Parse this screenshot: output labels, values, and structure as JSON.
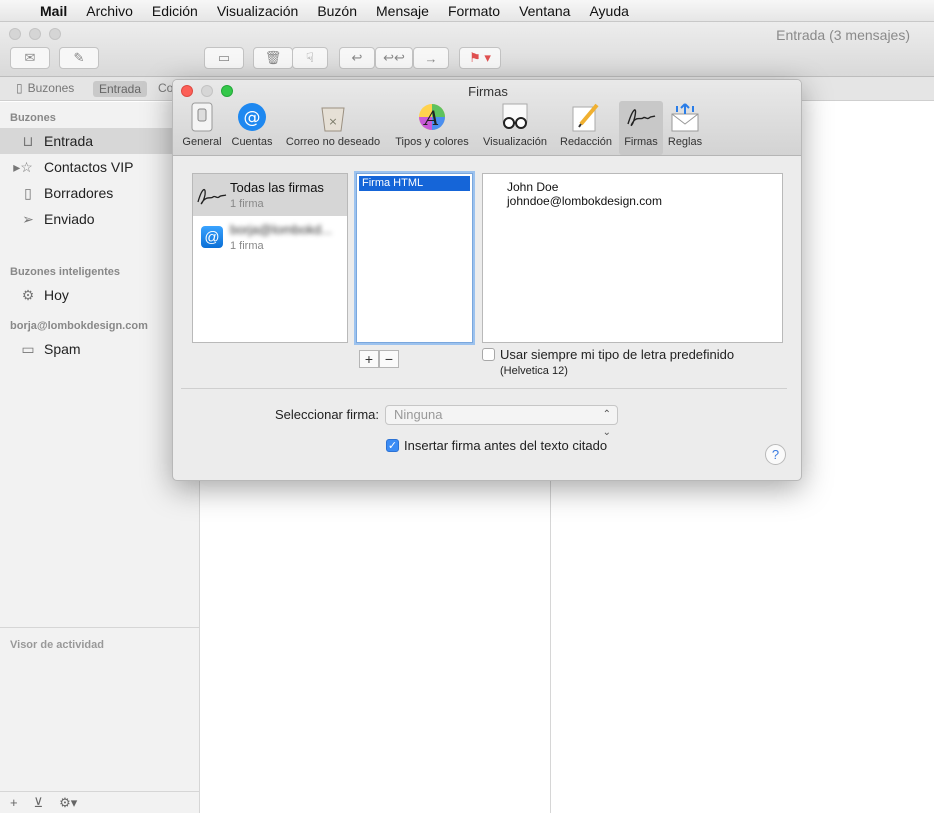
{
  "menubar": {
    "app": "Mail",
    "items": [
      "Archivo",
      "Edición",
      "Visualización",
      "Buzón",
      "Mensaje",
      "Formato",
      "Ventana",
      "Ayuda"
    ]
  },
  "window": {
    "title": "Entrada (3 mensajes)"
  },
  "favorites": {
    "mailboxes": "Buzones",
    "inbox": "Entrada",
    "truncated": "Co"
  },
  "sidebar": {
    "section_mailboxes": "Buzones",
    "items": [
      "Entrada",
      "Contactos VIP",
      "Borradores",
      "Enviado"
    ],
    "section_smart": "Buzones inteligentes",
    "smart_items": [
      "Hoy"
    ],
    "section_account": "borja@lombokdesign.com",
    "account_items": [
      "Spam"
    ],
    "activity": "Visor de actividad"
  },
  "dialog": {
    "title": "Firmas",
    "tabs": [
      "General",
      "Cuentas",
      "Correo no deseado",
      "Tipos y colores",
      "Visualización",
      "Redacción",
      "Firmas",
      "Reglas"
    ],
    "selected_tab": "Firmas",
    "accounts": [
      {
        "name": "Todas las firmas",
        "count": "1 firma"
      },
      {
        "name": "borja@lombokd...",
        "count": "1 firma"
      }
    ],
    "signatures": [
      "Firma HTML"
    ],
    "preview": {
      "line1": "John Doe",
      "line2": "johndoe@lombokdesign.com"
    },
    "add": "+",
    "remove": "−",
    "use_default_font": "Usar siempre mi tipo de letra predefinido",
    "default_font": "(Helvetica 12)",
    "select_label": "Seleccionar firma:",
    "select_value": "Ninguna",
    "insert_before": "Insertar firma antes del texto citado",
    "help": "?"
  }
}
